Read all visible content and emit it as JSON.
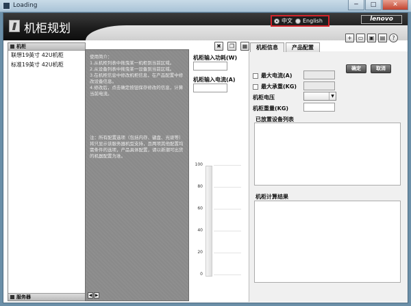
{
  "window": {
    "title": "Loading",
    "minimize": "─",
    "maximize": "□",
    "close": "✕"
  },
  "app": {
    "title": "机柜规划",
    "brand": "lenovo"
  },
  "language": {
    "options": [
      {
        "label": "中文",
        "selected": true
      },
      {
        "label": "English",
        "selected": false
      }
    ]
  },
  "top_tools": [
    "add-icon",
    "save-icon",
    "print-icon",
    "layout-icon",
    "help-icon"
  ],
  "top_tool_glyphs": [
    "+",
    "▭",
    "▣",
    "▤",
    "?"
  ],
  "left_panel": {
    "header": "机柜",
    "items": [
      "联想19英寸 42U机柜",
      "标准19英寸 42U机柜"
    ],
    "footer": "服务器"
  },
  "instructions": {
    "text": "使用简介：\n1.从机柜列表中拖曳某一机柜到当前区域。\n2.从设备列表中拖曳某一设备到当前区域。\n3.在机柜信息中修改机柜信息，在产品配置中修改设备信息。\n4.修改后，点击确定按钮保存修改的信息，计算当前电流。",
    "note": "注：所有配置选项（包括内存、键盘、光驱等）将只显示该服务器机型支持，且两项其他配置均需条件的选项，产品具体配置，请以新潮可出货的机器配置为准。"
  },
  "nav": {
    "prev": "◀",
    "next": "▶"
  },
  "middle": {
    "tools": [
      "delete-icon",
      "copy-icon",
      "clear-icon"
    ],
    "tool_glyphs": [
      "✖",
      "❐",
      "▦"
    ],
    "power_label": "机柜输入功耗(W)",
    "current_label": "机柜输入电流(A)",
    "scale_ticks": [
      "100",
      "80",
      "60",
      "40",
      "20",
      "0"
    ]
  },
  "tabs": [
    {
      "label": "机柜信息",
      "active": true
    },
    {
      "label": "产品配置",
      "active": false
    }
  ],
  "rack_info": {
    "max_current_label": "最大电流(A)",
    "max_load_label": "最大承重(KG)",
    "voltage_label": "机柜电压",
    "weight_label": "机柜重量(KG)",
    "ok_button": "确定",
    "cancel_button": "取消",
    "placed_devices_label": "已放置设备列表",
    "result_label": "机柜计算结果",
    "select_arrow": "▼"
  }
}
